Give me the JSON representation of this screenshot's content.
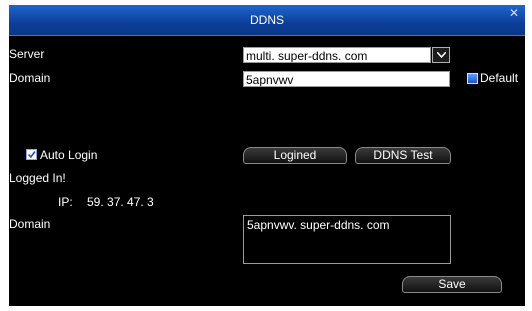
{
  "dialog": {
    "title": "DDNS",
    "close_icon": "close-icon",
    "colors": {
      "titlebar": "#1f66cf",
      "background": "#000000"
    }
  },
  "server": {
    "label": "Server",
    "value": "multi. super-ddns. com"
  },
  "domain": {
    "label": "Domain",
    "value": "5apnvwv",
    "default_label": "Default"
  },
  "auto_login": {
    "label": "Auto Login",
    "checked": true
  },
  "status": {
    "logged_in_text": "Logged In!",
    "ip_label": "IP:",
    "ip_value": "59. 37. 47.  3"
  },
  "buttons": {
    "logined": "Logined",
    "ddns_test": "DDNS Test",
    "save": "Save"
  },
  "domain_result": {
    "label": "Domain",
    "value": "5apnvwv. super-ddns. com"
  }
}
